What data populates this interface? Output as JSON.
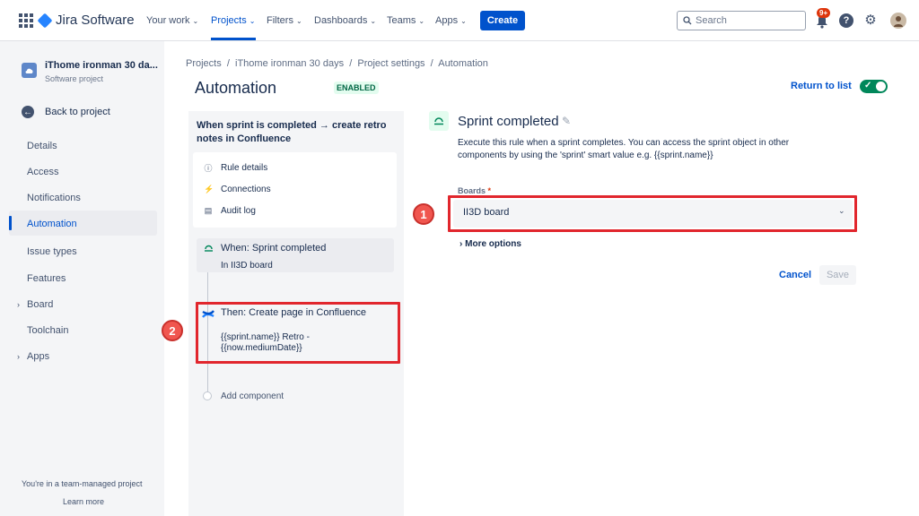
{
  "topnav": {
    "product": "Jira Software",
    "items": [
      {
        "label": "Your work"
      },
      {
        "label": "Projects"
      },
      {
        "label": "Filters"
      },
      {
        "label": "Dashboards"
      },
      {
        "label": "Teams"
      },
      {
        "label": "Apps"
      }
    ],
    "create_label": "Create",
    "search_placeholder": "Search",
    "notification_badge": "9+"
  },
  "sidebar": {
    "project_name": "iThome ironman 30 da...",
    "project_type": "Software project",
    "back_label": "Back to project",
    "items": [
      {
        "label": "Details"
      },
      {
        "label": "Access"
      },
      {
        "label": "Notifications"
      },
      {
        "label": "Automation"
      },
      {
        "label": "Issue types"
      },
      {
        "label": "Features"
      },
      {
        "label": "Board"
      },
      {
        "label": "Toolchain"
      },
      {
        "label": "Apps"
      }
    ],
    "footer_text": "You're in a team-managed project",
    "footer_link": "Learn more"
  },
  "header": {
    "breadcrumb": "Projects  /  iThome ironman 30 days  /  Project settings  /  Automation",
    "title": "Automation",
    "status_badge": "ENABLED",
    "return_label": "Return to list"
  },
  "rule": {
    "title": "When sprint is completed → create retro notes in Confluence",
    "menu": [
      {
        "label": "Rule details"
      },
      {
        "label": "Connections"
      },
      {
        "label": "Audit log"
      }
    ],
    "when_title": "When: Sprint completed",
    "when_sub": "In II3D board",
    "then_title": "Then: Create page in Confluence",
    "then_sub": "{{sprint.name}} Retro - {{now.mediumDate}}",
    "add_component": "Add component"
  },
  "trigger": {
    "title": "Sprint completed",
    "description": "Execute this rule when a sprint completes. You can access the sprint object in other components by using the 'sprint' smart value e.g. {{sprint.name}}",
    "boards_label": "Boards",
    "boards_required": "*",
    "boards_value": "II3D board",
    "more_options": "More options",
    "cancel_label": "Cancel",
    "save_label": "Save"
  },
  "annotations": {
    "marker_1": "1",
    "marker_2": "2"
  },
  "colors": {
    "accent": "#0052cc",
    "highlight": "#e1262d",
    "success": "#00875a"
  }
}
